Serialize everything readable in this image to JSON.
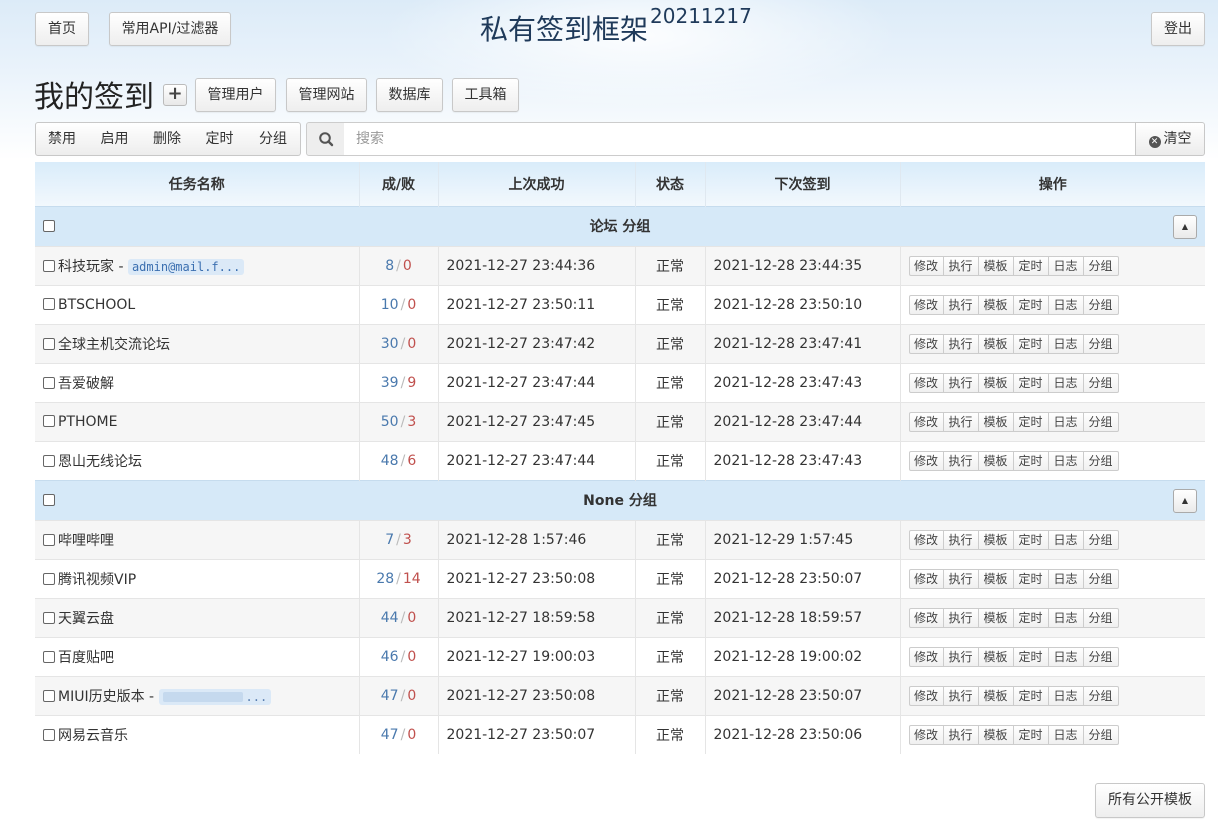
{
  "nav": {
    "home": "首页",
    "api": "常用API/过滤器",
    "title": "私有签到框架",
    "version": "20211217",
    "logout": "登出"
  },
  "heading": "我的签到",
  "add_icon": "plus-icon",
  "admin_buttons": [
    "管理用户",
    "管理网站",
    "数据库",
    "工具箱"
  ],
  "actions": [
    "禁用",
    "启用",
    "删除",
    "定时",
    "分组"
  ],
  "search": {
    "placeholder": "搜索",
    "clear": "清空",
    "icon": "search-icon"
  },
  "columns": [
    "任务名称",
    "成/败",
    "上次成功",
    "状态",
    "下次签到",
    "操作"
  ],
  "op_labels": [
    "修改",
    "执行",
    "模板",
    "定时",
    "日志",
    "分组"
  ],
  "groups": [
    {
      "label": "论坛 分组",
      "tasks": [
        {
          "name": "科技玩家 - ",
          "tag": "admin@mail.f...",
          "success": "8",
          "fail": "0",
          "last": "2021-12-27 23:44:36",
          "status": "正常",
          "next": "2021-12-28 23:44:35"
        },
        {
          "name": "BTSCHOOL",
          "success": "10",
          "fail": "0",
          "last": "2021-12-27 23:50:11",
          "status": "正常",
          "next": "2021-12-28 23:50:10"
        },
        {
          "name": "全球主机交流论坛",
          "success": "30",
          "fail": "0",
          "last": "2021-12-27 23:47:42",
          "status": "正常",
          "next": "2021-12-28 23:47:41"
        },
        {
          "name": "吾爱破解",
          "success": "39",
          "fail": "9",
          "last": "2021-12-27 23:47:44",
          "status": "正常",
          "next": "2021-12-28 23:47:43"
        },
        {
          "name": "PTHOME",
          "success": "50",
          "fail": "3",
          "last": "2021-12-27 23:47:45",
          "status": "正常",
          "next": "2021-12-28 23:47:44"
        },
        {
          "name": "恩山无线论坛",
          "success": "48",
          "fail": "6",
          "last": "2021-12-27 23:47:44",
          "status": "正常",
          "next": "2021-12-28 23:47:43"
        }
      ]
    },
    {
      "label": "None 分组",
      "tasks": [
        {
          "name": "哔哩哔哩",
          "success": "7",
          "fail": "3",
          "last": "2021-12-28 1:57:46",
          "status": "正常",
          "next": "2021-12-29 1:57:45"
        },
        {
          "name": "腾讯视频VIP",
          "success": "28",
          "fail": "14",
          "last": "2021-12-27 23:50:08",
          "status": "正常",
          "next": "2021-12-28 23:50:07"
        },
        {
          "name": "天翼云盘",
          "success": "44",
          "fail": "0",
          "last": "2021-12-27 18:59:58",
          "status": "正常",
          "next": "2021-12-28 18:59:57"
        },
        {
          "name": "百度贴吧",
          "success": "46",
          "fail": "0",
          "last": "2021-12-27 19:00:03",
          "status": "正常",
          "next": "2021-12-28 19:00:02"
        },
        {
          "name": "MIUI历史版本 - ",
          "tag": "...",
          "masked": true,
          "success": "47",
          "fail": "0",
          "last": "2021-12-27 23:50:08",
          "status": "正常",
          "next": "2021-12-28 23:50:07"
        },
        {
          "name": "网易云音乐",
          "success": "47",
          "fail": "0",
          "last": "2021-12-27 23:50:07",
          "status": "正常",
          "next": "2021-12-28 23:50:06"
        }
      ]
    }
  ],
  "footer_button": "所有公开模板"
}
